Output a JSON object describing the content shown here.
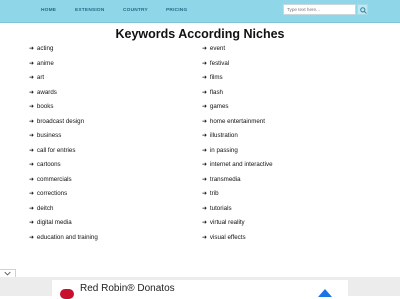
{
  "nav": {
    "items": [
      {
        "label": "HOME"
      },
      {
        "label": "EXTENSION"
      },
      {
        "label": "COUNTRY"
      },
      {
        "label": "PRICING"
      }
    ],
    "search_placeholder": "Type text here..."
  },
  "page_title": "Keywords According Niches",
  "keywords": {
    "arrow": "➜",
    "left": [
      "acting",
      "anime",
      "art",
      "awards",
      "books",
      "broadcast design",
      "business",
      "call for entries",
      "cartoons",
      "commercials",
      "corrections",
      "deitch",
      "digital media",
      "education and training"
    ],
    "right": [
      "event",
      "festival",
      "films",
      "flash",
      "games",
      "home entertainment",
      "illustration",
      "in passing",
      "internet and interactive",
      "transmedia",
      "trib",
      "tutorials",
      "virtual reality",
      "visual effects"
    ]
  },
  "ad": {
    "title": "Red Robin® Donatos"
  },
  "colors": {
    "topbar": "#8fd6e8",
    "nav_text": "#1f6b85",
    "ad_logo": "#c8102e",
    "ad_arrow": "#1a73e8"
  }
}
